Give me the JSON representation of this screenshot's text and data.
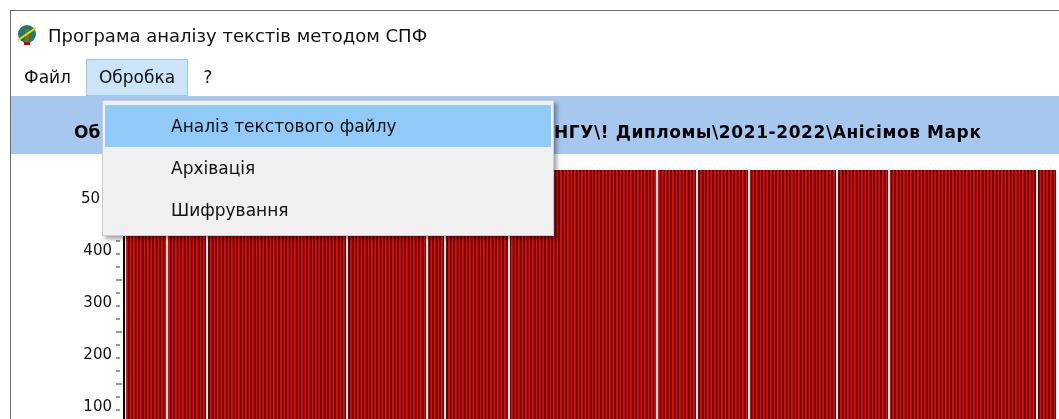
{
  "window": {
    "title": "Програма аналізу текстів методом СПФ"
  },
  "menu_bar": [
    {
      "label": "Файл",
      "selected": false
    },
    {
      "label": "Обробка",
      "selected": true
    },
    {
      "label": "?",
      "selected": false
    }
  ],
  "dropdown": [
    {
      "label": "Аналіз текстового файлу",
      "selected": true
    },
    {
      "label": "Архівація",
      "selected": false
    },
    {
      "label": "Шифрування",
      "selected": false
    }
  ],
  "header": {
    "text_left": "Об",
    "text_right": "НГУ\\! Дипломы\\2021-2022\\Анісімов Марк"
  },
  "chart": {
    "y_ticks": [
      "50",
      "400",
      "300",
      "200",
      "100"
    ]
  }
}
